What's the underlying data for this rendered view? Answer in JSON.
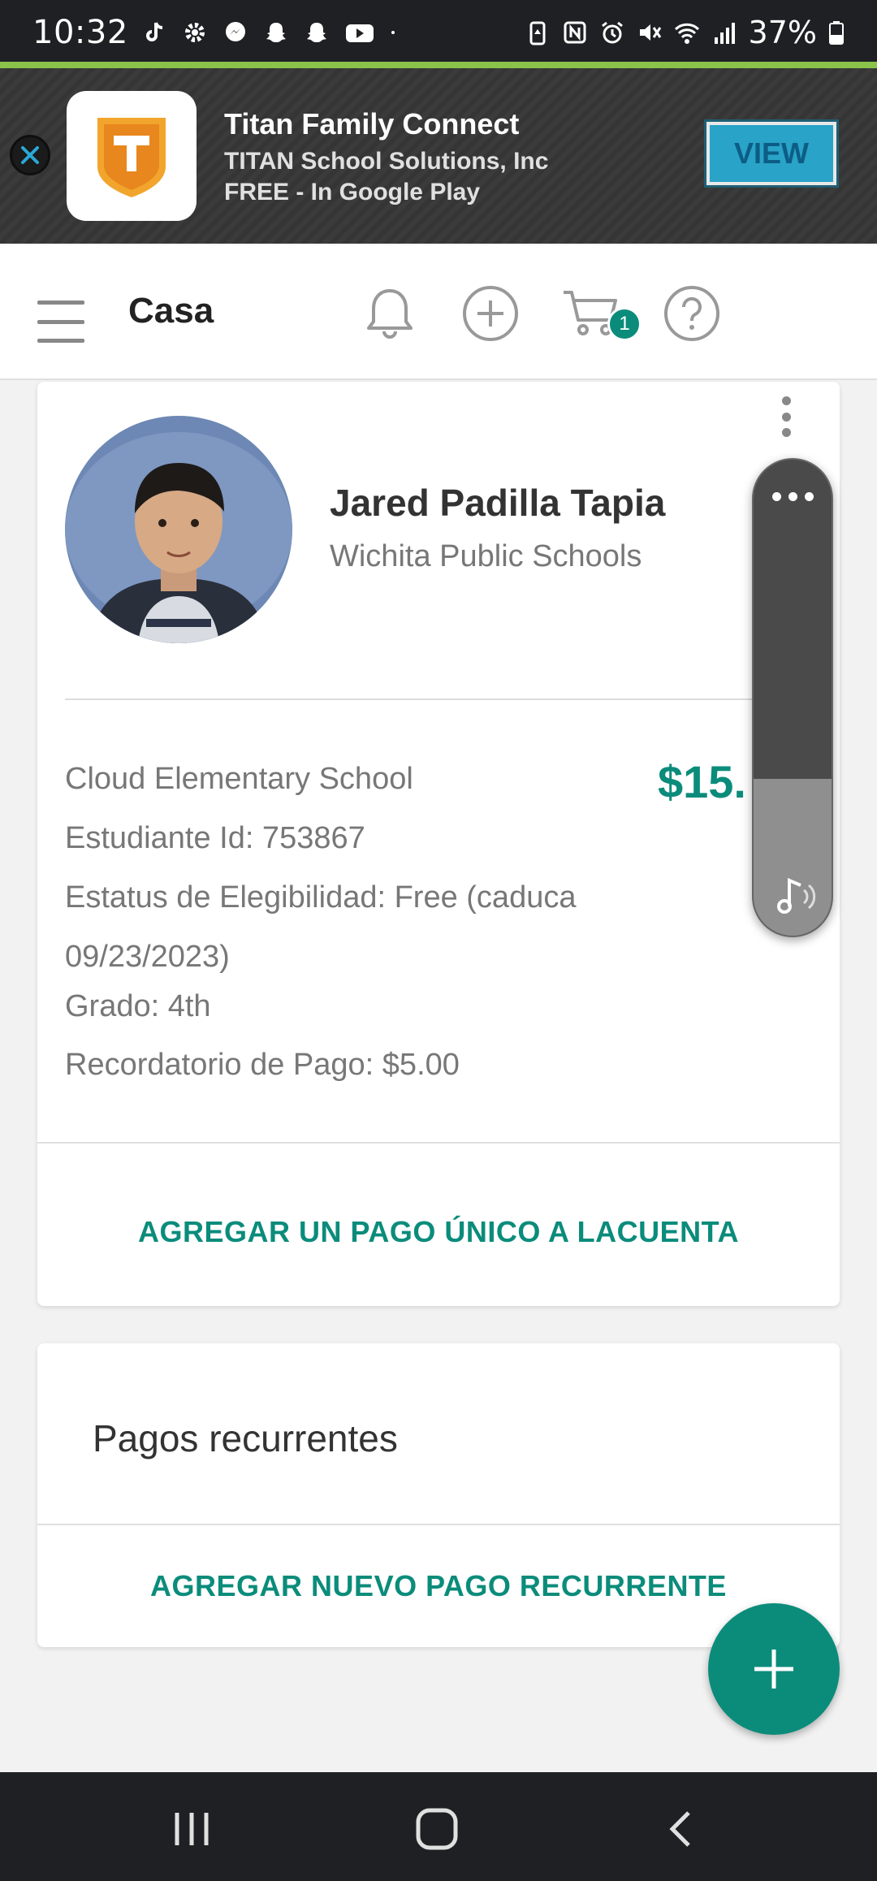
{
  "status_bar": {
    "time": "10:32",
    "battery": "37%"
  },
  "ad": {
    "title": "Titan Family Connect",
    "company": "TITAN School Solutions, Inc",
    "price_store": "FREE - In Google Play",
    "view_label": "VIEW"
  },
  "header": {
    "title": "Casa",
    "cart_count": "1"
  },
  "student": {
    "name": "Jared Padilla Tapia",
    "district": "Wichita Public Schools",
    "school": "Cloud Elementary School",
    "amount": "$15.",
    "student_id": "Estudiante Id: 753867",
    "eligibility_line1": "Estatus de Elegibilidad: Free (caduca",
    "eligibility_line2": "09/23/2023)",
    "grade": "Grado: 4th",
    "payment_reminder": "Recordatorio de Pago: $5.00",
    "add_payment_label": "AGREGAR UN PAGO ÚNICO A LACUENTA"
  },
  "recurring": {
    "title": "Pagos recurrentes",
    "add_label": "AGREGAR NUEVO PAGO RECURRENTE"
  },
  "volume": {
    "level": 0.33
  },
  "colors": {
    "accent": "#0b8c7b",
    "status_bar": "#1f2023",
    "ad_button": "#29a3c7"
  },
  "icons": {
    "header": [
      "menu-icon",
      "bell-icon",
      "add-circle-icon",
      "cart-icon",
      "help-icon"
    ],
    "nav": [
      "recent-apps-icon",
      "home-icon",
      "back-icon"
    ]
  }
}
